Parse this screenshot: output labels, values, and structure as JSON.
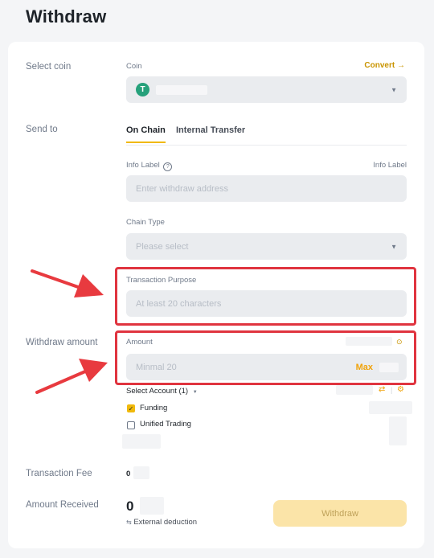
{
  "page": {
    "title": "Withdraw"
  },
  "select_coin": {
    "label": "Select coin",
    "field_label": "Coin",
    "convert_label": "Convert",
    "convert_arrow": "→",
    "coin_icon_letter": "T"
  },
  "send_to": {
    "label": "Send to",
    "tabs": [
      "On Chain",
      "Internal Transfer"
    ],
    "info_label": "Info Label",
    "info_label_right": "Info Label",
    "address_placeholder": "Enter withdraw address",
    "chain_type_label": "Chain Type",
    "chain_type_placeholder": "Please select"
  },
  "transaction_purpose": {
    "label": "Transaction Purpose",
    "placeholder": "At least 20 characters"
  },
  "withdraw_amount": {
    "label": "Withdraw amount",
    "field_label": "Amount",
    "placeholder": "Minmal 20",
    "max_label": "Max"
  },
  "account": {
    "select_label": "Select Account (1)",
    "options": [
      {
        "label": "Funding",
        "checked": true
      },
      {
        "label": "Unified Trading",
        "checked": false
      }
    ]
  },
  "fee": {
    "label": "Transaction Fee",
    "value": "0"
  },
  "received": {
    "label": "Amount Received",
    "value": "0",
    "external_deduction": "External deduction"
  },
  "withdraw_button": {
    "label": "Withdraw"
  },
  "colors": {
    "accent": "#f0b90b",
    "link": "#c99400",
    "highlight": "#e0343f",
    "arrow": "#e83a3f",
    "coin_icon": "#26a17b",
    "button_disabled": "#fbe4a8"
  }
}
